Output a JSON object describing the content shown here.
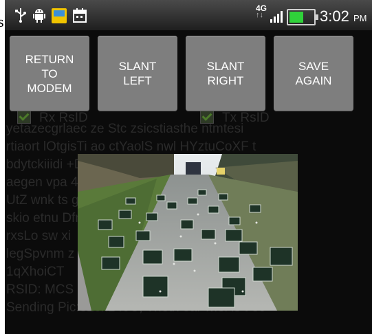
{
  "clipped_char": "s",
  "status_bar": {
    "icons": [
      "usb-icon",
      "android-icon",
      "notification-icon",
      "calendar-icon"
    ],
    "network": "4G",
    "signal": "signal-bars-icon",
    "battery": "battery-icon",
    "time": "3:02",
    "ampm": "PM",
    "battery_color": "#2fd23a"
  },
  "buttons": [
    {
      "label": "RETURN\nTO\nMODEM"
    },
    {
      "label": "SLANT\nLEFT"
    },
    {
      "label": "SLANT\nRIGHT"
    },
    {
      "label": "SAVE\nAGAIN"
    }
  ],
  "checkboxes": [
    {
      "label": "Rx RsID"
    },
    {
      "label": "Tx RsID"
    }
  ],
  "background_text": [
    "yetazecgrlaec ze Stc  zsicstiasthe  ntmtesi",
    "rtiaort  lOtgisTi  ao ctYaolS nwl HYztuCoXF t",
    "bdytckiiidi                                      +Da^eu",
    "aegen vpa                                        4nnwo",
    "UtZ wnk ts                                     g  t aa",
    "skio etnu                                       Dfnq>TA",
    "rxsLo  sw                                       xi",
    "legSpvnm                                       z  cn  cc&",
    "1qXhoiCT",
    "RSID: MCS",
    "Sending Pic:320x240C;  Tnetx  ear wiei is t ec"
  ]
}
